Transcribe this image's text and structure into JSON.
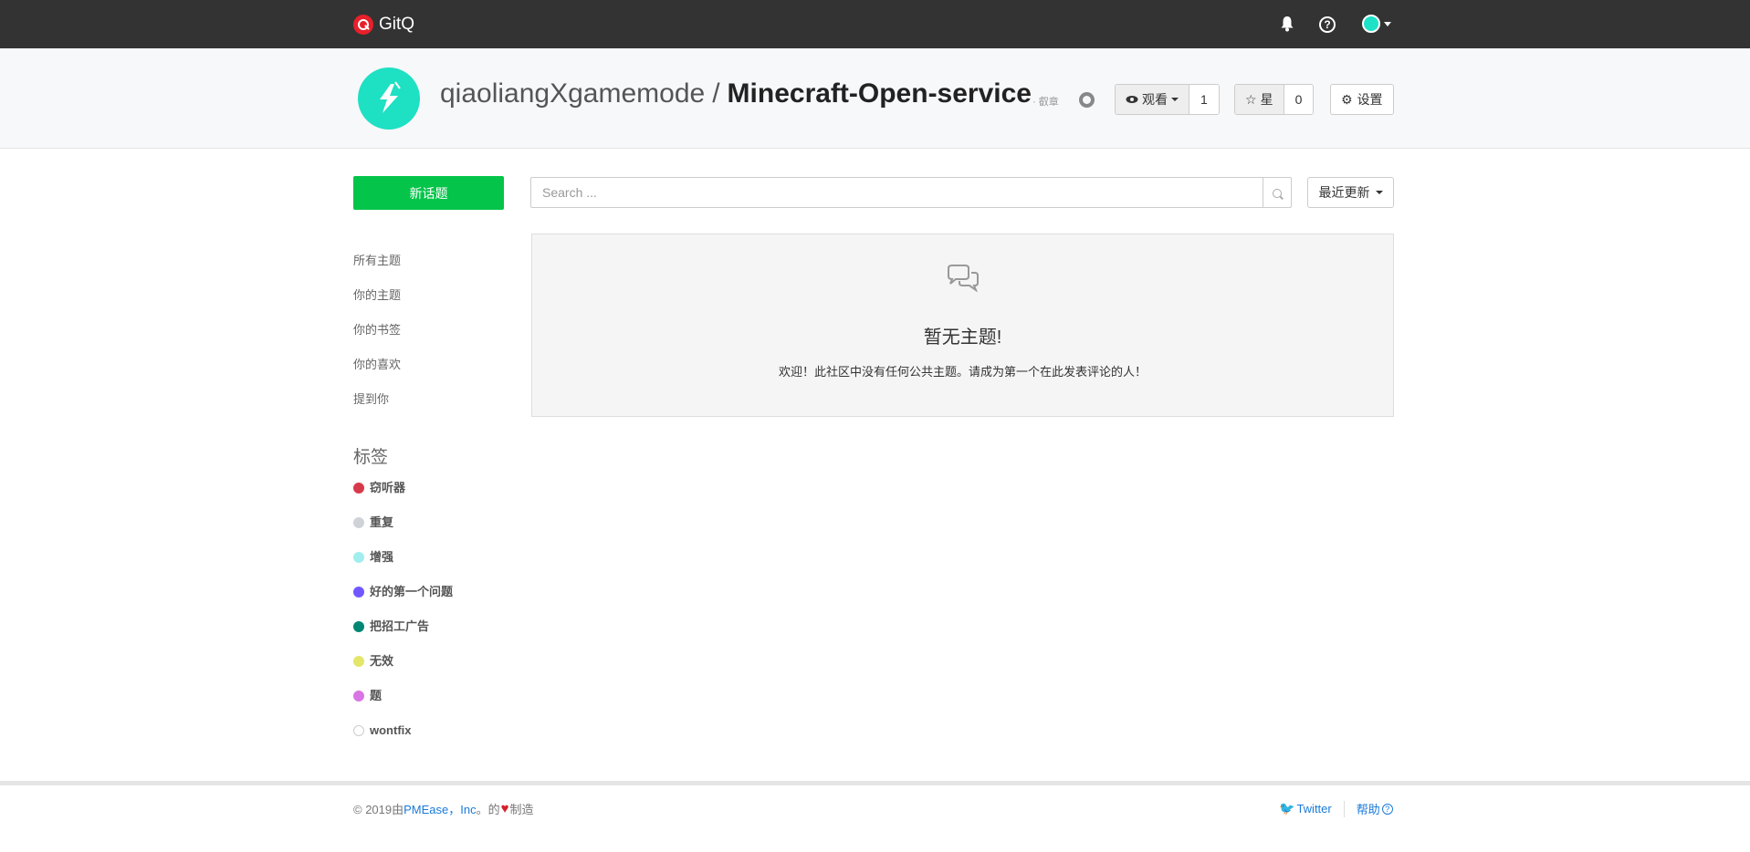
{
  "topnav": {
    "brand": "GitQ"
  },
  "repo": {
    "owner": "qiaoliangXgamemode",
    "separator": "/",
    "name": "Minecraft-Open-service",
    "forked_label": "· 叡章",
    "watch_label": "观看",
    "watch_count": "1",
    "star_label": "星",
    "star_count": "0",
    "settings_label": "设置"
  },
  "sidebar": {
    "new_topic": "新话题",
    "links": [
      "所有主题",
      "你的主题",
      "你的书签",
      "你的喜欢",
      "提到你"
    ],
    "labels_title": "标签",
    "labels": [
      {
        "name": "窃听器",
        "color": "#d73a4a"
      },
      {
        "name": "重复",
        "color": "#cfd3d7"
      },
      {
        "name": "增强",
        "color": "#a2eeef"
      },
      {
        "name": "好的第一个问题",
        "color": "#7057ff"
      },
      {
        "name": "把招工广告",
        "color": "#008672"
      },
      {
        "name": "无效",
        "color": "#e4e669"
      },
      {
        "name": "题",
        "color": "#d876e3"
      },
      {
        "name": "wontfix",
        "color": "#ffffff"
      }
    ]
  },
  "main": {
    "search_placeholder": "Search ...",
    "sort_label": "最近更新",
    "empty_title": "暂无主题!",
    "empty_desc": "欢迎！此社区中没有任何公共主题。请成为第一个在此发表评论的人！"
  },
  "footer": {
    "copyright_prefix": "© 2019由",
    "company": "PMEase，Inc",
    "made_mid": "。的",
    "made_suffix": "制造",
    "twitter": "Twitter",
    "help": "帮助"
  }
}
